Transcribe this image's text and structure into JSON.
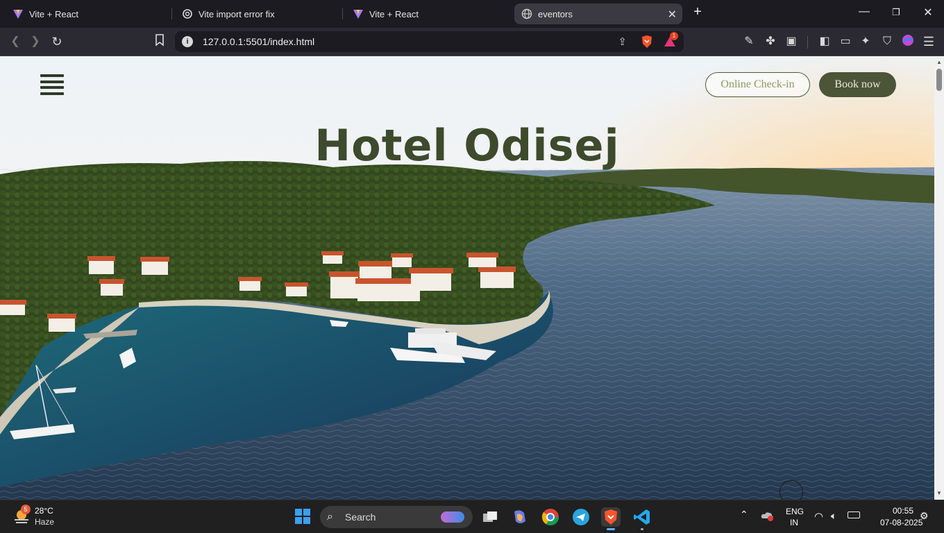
{
  "tabs": [
    {
      "title": "Vite + React",
      "icon": "vite-icon"
    },
    {
      "title": "Vite import error fix",
      "icon": "openai-icon"
    },
    {
      "title": "Vite + React",
      "icon": "vite-icon"
    },
    {
      "title": "eventors",
      "icon": "globe-icon",
      "active": true
    }
  ],
  "address_bar": {
    "url": "127.0.0.1:5501/index.html"
  },
  "brave_badge": "1",
  "page": {
    "title": "Hotel Odisej",
    "checkin_label": "Online Check-in",
    "book_label": "Book now"
  },
  "taskbar": {
    "weather_badge": "5",
    "temperature": "28°C",
    "condition": "Haze",
    "search_label": "Search",
    "lang": "ENG",
    "region": "IN",
    "time": "00:55",
    "date": "07-08-2025"
  }
}
